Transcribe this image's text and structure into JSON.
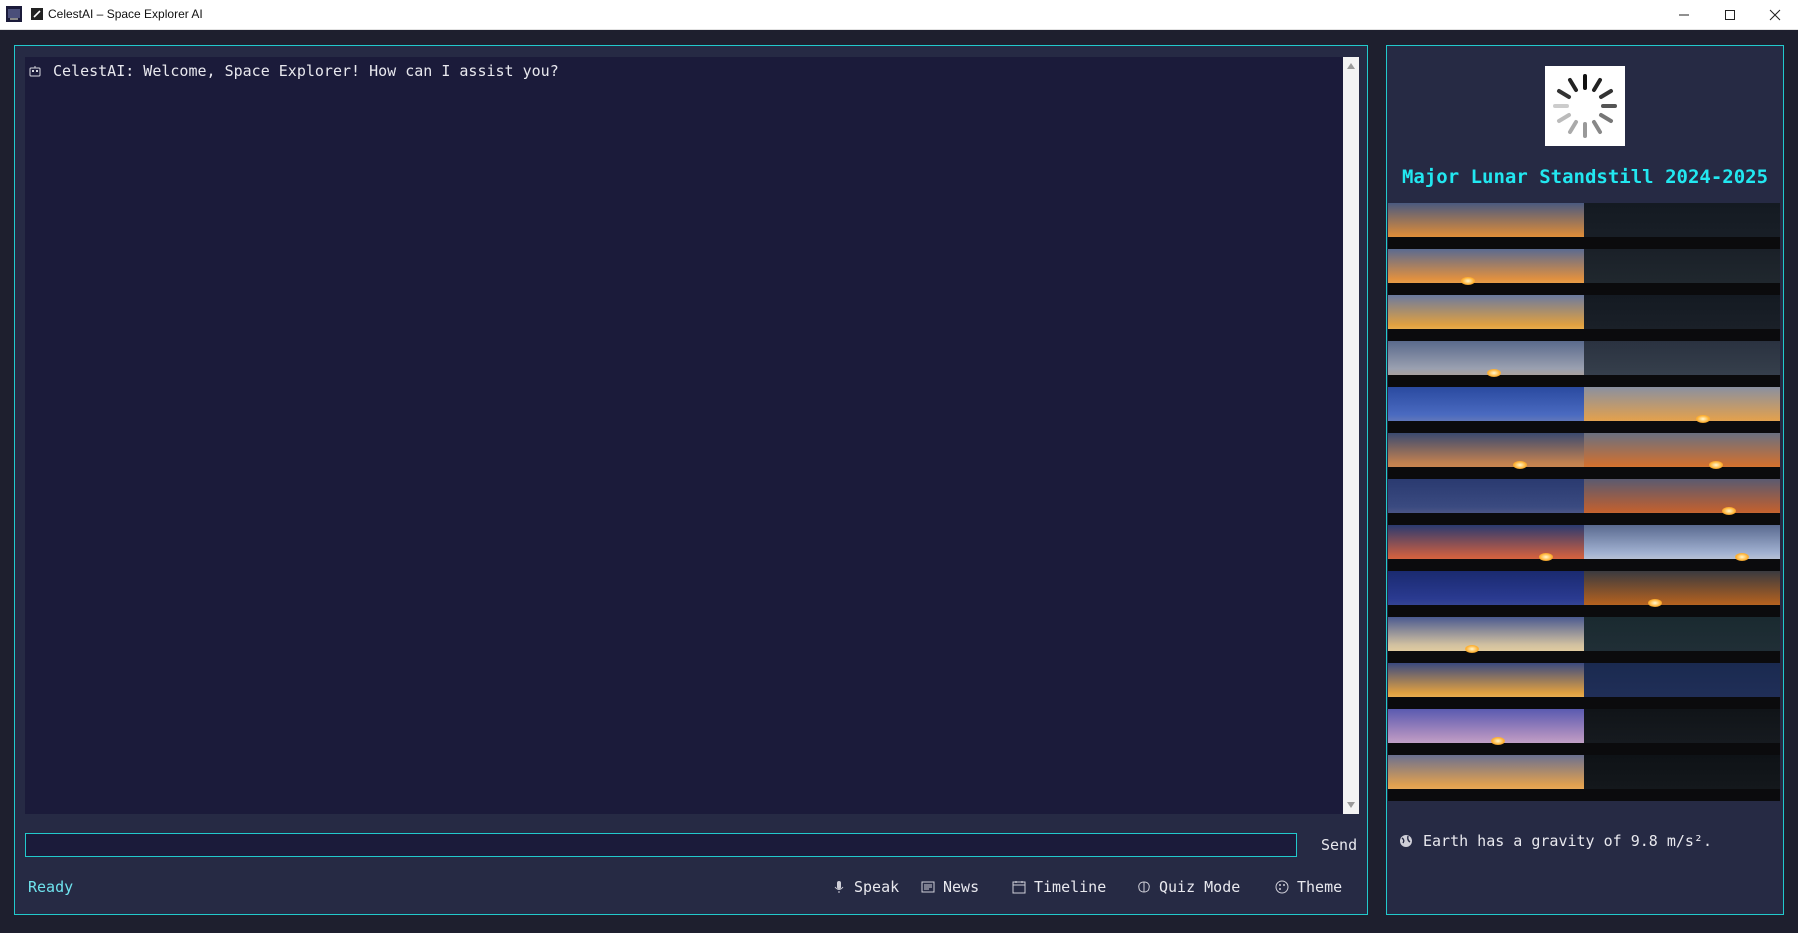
{
  "window": {
    "title": "CelestAI – Space Explorer AI"
  },
  "chat": {
    "messages": [
      {
        "sender_icon": "robot-icon",
        "text": "CelestAI: Welcome, Space Explorer! How can I assist you?"
      }
    ],
    "input_value": "",
    "send_label": "Send"
  },
  "status": {
    "text": "Ready"
  },
  "toolbar": {
    "buttons": [
      {
        "icon": "microphone-icon",
        "label": "Speak"
      },
      {
        "icon": "newspaper-icon",
        "label": "News"
      },
      {
        "icon": "calendar-icon",
        "label": "Timeline"
      },
      {
        "icon": "brain-icon",
        "label": "Quiz Mode"
      },
      {
        "icon": "palette-icon",
        "label": "Theme"
      }
    ]
  },
  "side": {
    "loading_icon": "spinner-icon",
    "feature_title": "Major Lunar Standstill 2024-2025",
    "fact_icon": "globe-icon",
    "fact_text": "Earth has a gravity of 9.8 m/s²."
  },
  "colors": {
    "accent": "#22c9cc",
    "panel_bg": "#262a44",
    "chat_bg": "#1b1b3a",
    "title_text": "#22e7f0",
    "status_text": "#6fe3ee"
  }
}
